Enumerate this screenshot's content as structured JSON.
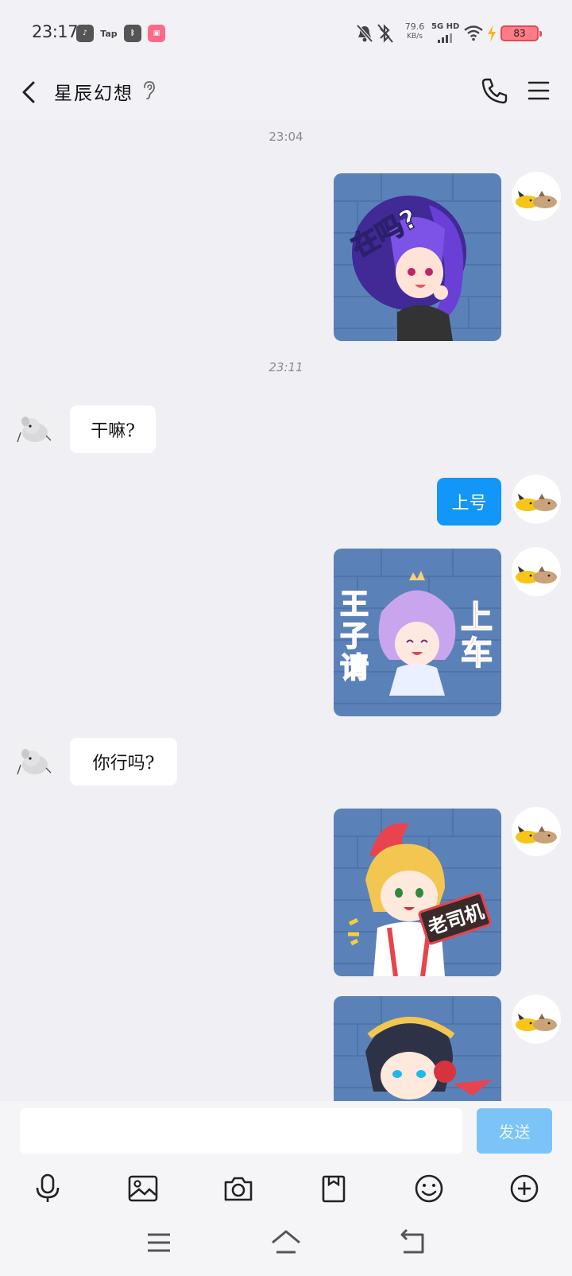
{
  "status_bar": {
    "time": "23:17",
    "app_icons": [
      "tiktok-icon",
      "taptap-icon",
      "bluetooth-app-icon",
      "bilibili-icon"
    ],
    "tap_label": "Tap",
    "net_speed_value": "79.6",
    "net_speed_unit": "KB/s",
    "network_type": "5G HD",
    "battery": "83"
  },
  "header": {
    "title": "星辰幻想"
  },
  "chat": {
    "timestamps": [
      "23:04",
      "23:11"
    ],
    "messages": [
      {
        "side": "self",
        "type": "sticker",
        "sticker": "在吗?"
      },
      {
        "side": "other",
        "type": "text",
        "text": "干嘛?"
      },
      {
        "side": "self",
        "type": "text",
        "text": "上号"
      },
      {
        "side": "self",
        "type": "sticker",
        "sticker": "王子请上车"
      },
      {
        "side": "other",
        "type": "text",
        "text": "你行吗?"
      },
      {
        "side": "self",
        "type": "sticker",
        "sticker": "老司机"
      },
      {
        "side": "self",
        "type": "sticker",
        "sticker": ""
      }
    ],
    "sticker_texts": {
      "s1": "在吗?",
      "s2_left": [
        "王",
        "子",
        "请"
      ],
      "s2_right": [
        "上",
        "车"
      ],
      "s3": "老司机"
    }
  },
  "input": {
    "value": "",
    "send_label": "发送"
  },
  "toolbar": [
    "microphone-icon",
    "image-icon",
    "camera-icon",
    "file-icon",
    "emoji-icon",
    "plus-icon"
  ],
  "nav": [
    "menu-icon",
    "home-icon",
    "back-icon"
  ],
  "colors": {
    "bubble_self": "#1296f7",
    "send_button": "#7cc4f8",
    "background": "#efeff4",
    "battery": "#ff7b86"
  }
}
